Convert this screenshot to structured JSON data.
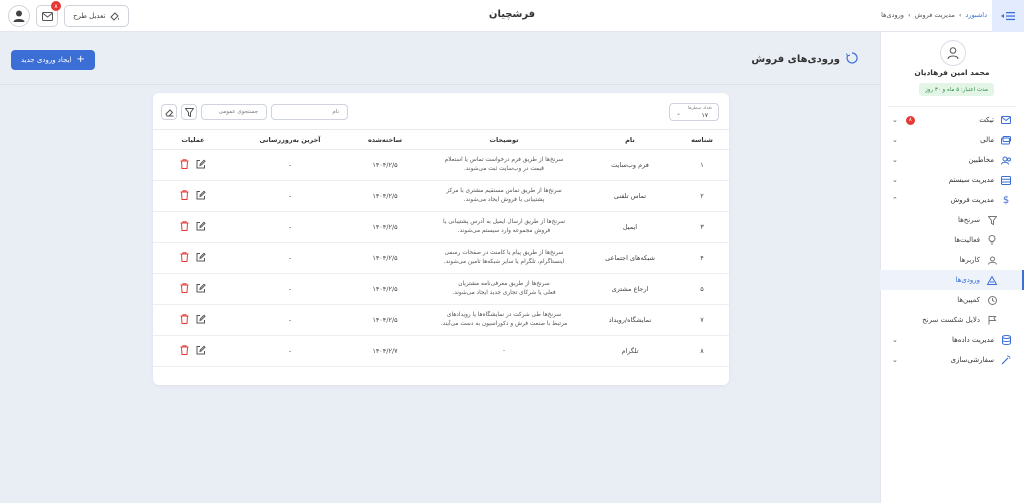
{
  "app": {
    "brand": "فرشچیان",
    "theme_btn_label": "تعدیل طرح",
    "notif_count": "۸"
  },
  "breadcrumb": {
    "home": "داشبورد",
    "section": "مدیریت فروش",
    "current": "ورودی‌ها",
    "sep": "›"
  },
  "user": {
    "name": "محمد امین فرهادیان",
    "credit": "مدت اعتبار: ۵ ماه و ۳۰ روز"
  },
  "sidebar": {
    "items": [
      {
        "label": "تیکت",
        "icon": "ticket-icon",
        "badge": "۸",
        "chev": "⌄"
      },
      {
        "label": "مالی",
        "icon": "finance-icon",
        "chev": "⌄"
      },
      {
        "label": "مخاطبین",
        "icon": "contacts-icon",
        "chev": "⌄"
      },
      {
        "label": "مدیریت سیستم",
        "icon": "system-icon",
        "chev": "⌄"
      },
      {
        "label": "مدیریت فروش",
        "icon": "dollar-icon",
        "chev": "⌃"
      },
      {
        "label": "سرنخ‌ها",
        "icon": "funnel-icon"
      },
      {
        "label": "فعالیت‌ها",
        "icon": "bulb-icon"
      },
      {
        "label": "کاربرها",
        "icon": "user-icon"
      },
      {
        "label": "ورودی‌ها",
        "icon": "inputs-icon"
      },
      {
        "label": "کمپین‌ها",
        "icon": "campaign-icon"
      },
      {
        "label": "دلایل شکست سرنخ",
        "icon": "flag-icon"
      },
      {
        "label": "مدیریت داده‌ها",
        "icon": "database-icon",
        "chev": "⌄"
      },
      {
        "label": "سفارشی‌سازی",
        "icon": "wand-icon",
        "chev": "⌄"
      }
    ]
  },
  "page": {
    "title": "ورودی‌های فروش",
    "create_btn": "ایجاد ورودی جدید"
  },
  "filters": {
    "rows_label": "تعداد سطرها",
    "rows_value": "۱۷",
    "general_search_placeholder": "جستجوی عمومی",
    "name_placeholder": "نام"
  },
  "table": {
    "headers": [
      "شناسه",
      "نام",
      "توضیحات",
      "ساخته‌شده",
      "آخرین به‌روزرسانی",
      "عملیات"
    ],
    "rows": [
      {
        "id": "۱",
        "name": "فرم وب‌سایت",
        "desc1": "سرنخ‌ها از طریق فرم درخواست تماس یا استعلام",
        "desc2": "قیمت در وب‌سایت ثبت می‌شوند.",
        "created": "۱۴۰۴/۲/۵",
        "updated": "-"
      },
      {
        "id": "۲",
        "name": "تماس تلفنی",
        "desc1": "سرنخ‌ها از طریق تماس مستقیم مشتری با مرکز",
        "desc2": "پشتیبانی یا فروش ایجاد می‌شوند.",
        "created": "۱۴۰۴/۲/۵",
        "updated": "-"
      },
      {
        "id": "۳",
        "name": "ایمیل",
        "desc1": "سرنخ‌ها از طریق ارسال ایمیل به آدرس پشتیبانی یا",
        "desc2": "فروش مجموعه وارد سیستم می‌شوند.",
        "created": "۱۴۰۴/۲/۵",
        "updated": "-"
      },
      {
        "id": "۴",
        "name": "شبکه‌های اجتماعی",
        "desc1": "سرنخ‌ها از طریق پیام یا کامنت در صفحات رسمی",
        "desc2": "اینستاگرام، تلگرام یا سایر شبکه‌ها تامین می‌شوند.",
        "created": "۱۴۰۴/۲/۵",
        "updated": "-"
      },
      {
        "id": "۵",
        "name": "ارجاع مشتری",
        "desc1": "سرنخ‌ها از طریق معرفی‌نامه مشتریان",
        "desc2": "فعلی یا شرکای تجاری جدید ایجاد می‌شوند.",
        "created": "۱۴۰۴/۲/۵",
        "updated": "-"
      },
      {
        "id": "۷",
        "name": "نمایشگاه/رویداد",
        "desc1": "سرنخ‌ها طی شرکت در نمایشگاه‌ها یا رویدادهای",
        "desc2": "مرتبط با صنعت فرش و دکوراسیون به دست می‌آیند.",
        "created": "۱۴۰۴/۲/۵",
        "updated": "-"
      },
      {
        "id": "۸",
        "name": "تلگرام",
        "desc1": "-",
        "desc2": "",
        "created": "۱۴۰۴/۲/۷",
        "updated": "-"
      }
    ]
  }
}
